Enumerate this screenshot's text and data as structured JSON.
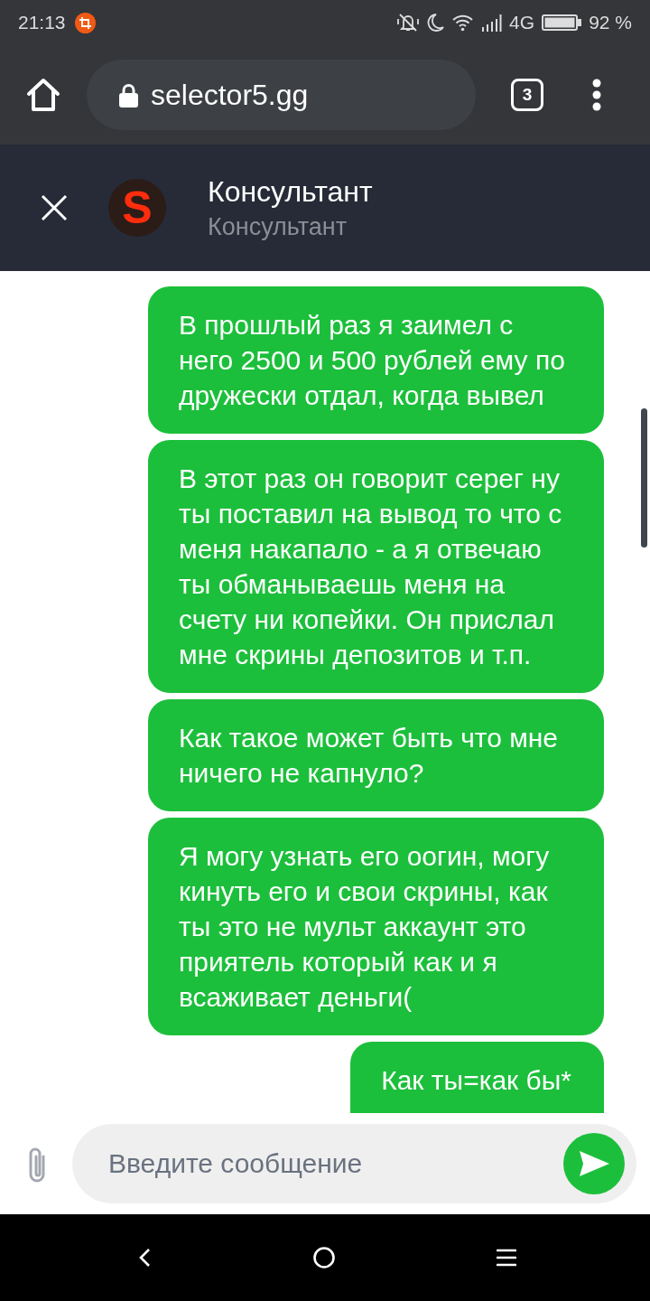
{
  "status_bar": {
    "time": "21:13",
    "network": "4G",
    "battery": "92 %"
  },
  "browser": {
    "url": "selector5.gg",
    "tab_count": "3"
  },
  "chat_header": {
    "avatar_letter": "S",
    "title": "Консультант",
    "subtitle": "Консультант"
  },
  "messages": [
    {
      "text": "В прошлый раз я заимел с него 2500 и 500 рублей ему по дружески отдал, когда вывел"
    },
    {
      "text": "В этот раз он говорит серег ну ты поставил на вывод то что с меня накапало - а я отвечаю ты обманываешь меня на счету ни копейки. Он прислал мне скрины депозитов и т.п."
    },
    {
      "text": "Как такое может быть что мне ничего не капнуло?"
    },
    {
      "text": "Я могу узнать его оогин, могу кинуть его и свои скрины, как ты это не мульт аккаунт это приятель который как и я всаживает деньги("
    },
    {
      "text": "Как ты=как бы*"
    }
  ],
  "composer": {
    "placeholder": "Введите сообщение"
  }
}
